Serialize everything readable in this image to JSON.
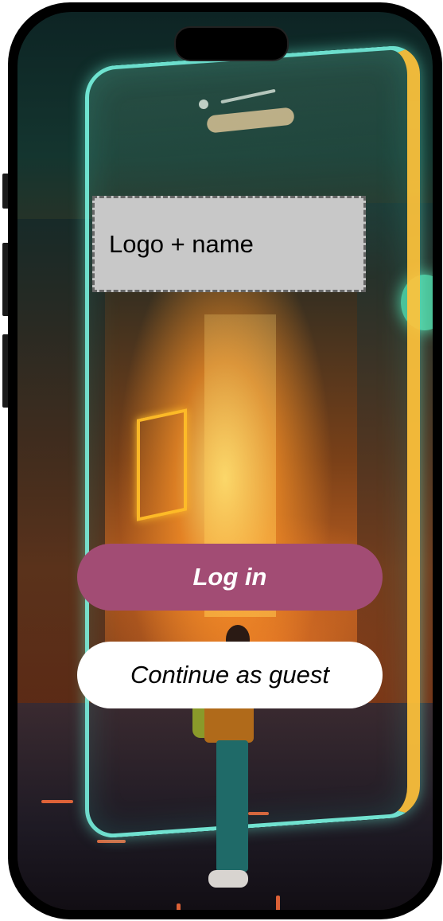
{
  "logo": {
    "label": "Logo + name"
  },
  "actions": {
    "login_label": "Log in",
    "guest_label": "Continue as guest"
  },
  "colors": {
    "login_button": "#a24c74",
    "guest_button": "#ffffff",
    "logo_placeholder": "#c8c8c8"
  },
  "icons": [
    "camera-notch-icon"
  ]
}
